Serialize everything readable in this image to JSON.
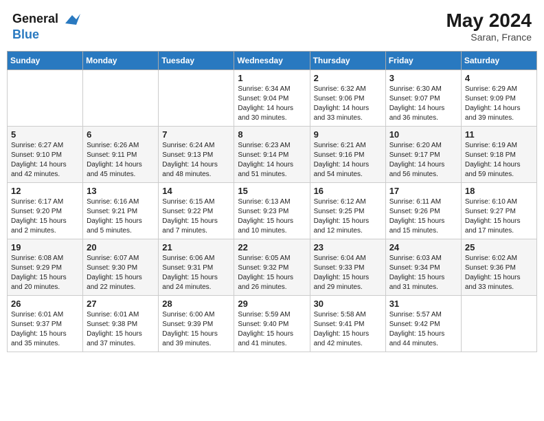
{
  "header": {
    "logo_line1": "General",
    "logo_line2": "Blue",
    "month_year": "May 2024",
    "location": "Saran, France"
  },
  "weekdays": [
    "Sunday",
    "Monday",
    "Tuesday",
    "Wednesday",
    "Thursday",
    "Friday",
    "Saturday"
  ],
  "weeks": [
    [
      {
        "num": "",
        "info": ""
      },
      {
        "num": "",
        "info": ""
      },
      {
        "num": "",
        "info": ""
      },
      {
        "num": "1",
        "info": "Sunrise: 6:34 AM\nSunset: 9:04 PM\nDaylight: 14 hours\nand 30 minutes."
      },
      {
        "num": "2",
        "info": "Sunrise: 6:32 AM\nSunset: 9:06 PM\nDaylight: 14 hours\nand 33 minutes."
      },
      {
        "num": "3",
        "info": "Sunrise: 6:30 AM\nSunset: 9:07 PM\nDaylight: 14 hours\nand 36 minutes."
      },
      {
        "num": "4",
        "info": "Sunrise: 6:29 AM\nSunset: 9:09 PM\nDaylight: 14 hours\nand 39 minutes."
      }
    ],
    [
      {
        "num": "5",
        "info": "Sunrise: 6:27 AM\nSunset: 9:10 PM\nDaylight: 14 hours\nand 42 minutes."
      },
      {
        "num": "6",
        "info": "Sunrise: 6:26 AM\nSunset: 9:11 PM\nDaylight: 14 hours\nand 45 minutes."
      },
      {
        "num": "7",
        "info": "Sunrise: 6:24 AM\nSunset: 9:13 PM\nDaylight: 14 hours\nand 48 minutes."
      },
      {
        "num": "8",
        "info": "Sunrise: 6:23 AM\nSunset: 9:14 PM\nDaylight: 14 hours\nand 51 minutes."
      },
      {
        "num": "9",
        "info": "Sunrise: 6:21 AM\nSunset: 9:16 PM\nDaylight: 14 hours\nand 54 minutes."
      },
      {
        "num": "10",
        "info": "Sunrise: 6:20 AM\nSunset: 9:17 PM\nDaylight: 14 hours\nand 56 minutes."
      },
      {
        "num": "11",
        "info": "Sunrise: 6:19 AM\nSunset: 9:18 PM\nDaylight: 14 hours\nand 59 minutes."
      }
    ],
    [
      {
        "num": "12",
        "info": "Sunrise: 6:17 AM\nSunset: 9:20 PM\nDaylight: 15 hours\nand 2 minutes."
      },
      {
        "num": "13",
        "info": "Sunrise: 6:16 AM\nSunset: 9:21 PM\nDaylight: 15 hours\nand 5 minutes."
      },
      {
        "num": "14",
        "info": "Sunrise: 6:15 AM\nSunset: 9:22 PM\nDaylight: 15 hours\nand 7 minutes."
      },
      {
        "num": "15",
        "info": "Sunrise: 6:13 AM\nSunset: 9:23 PM\nDaylight: 15 hours\nand 10 minutes."
      },
      {
        "num": "16",
        "info": "Sunrise: 6:12 AM\nSunset: 9:25 PM\nDaylight: 15 hours\nand 12 minutes."
      },
      {
        "num": "17",
        "info": "Sunrise: 6:11 AM\nSunset: 9:26 PM\nDaylight: 15 hours\nand 15 minutes."
      },
      {
        "num": "18",
        "info": "Sunrise: 6:10 AM\nSunset: 9:27 PM\nDaylight: 15 hours\nand 17 minutes."
      }
    ],
    [
      {
        "num": "19",
        "info": "Sunrise: 6:08 AM\nSunset: 9:29 PM\nDaylight: 15 hours\nand 20 minutes."
      },
      {
        "num": "20",
        "info": "Sunrise: 6:07 AM\nSunset: 9:30 PM\nDaylight: 15 hours\nand 22 minutes."
      },
      {
        "num": "21",
        "info": "Sunrise: 6:06 AM\nSunset: 9:31 PM\nDaylight: 15 hours\nand 24 minutes."
      },
      {
        "num": "22",
        "info": "Sunrise: 6:05 AM\nSunset: 9:32 PM\nDaylight: 15 hours\nand 26 minutes."
      },
      {
        "num": "23",
        "info": "Sunrise: 6:04 AM\nSunset: 9:33 PM\nDaylight: 15 hours\nand 29 minutes."
      },
      {
        "num": "24",
        "info": "Sunrise: 6:03 AM\nSunset: 9:34 PM\nDaylight: 15 hours\nand 31 minutes."
      },
      {
        "num": "25",
        "info": "Sunrise: 6:02 AM\nSunset: 9:36 PM\nDaylight: 15 hours\nand 33 minutes."
      }
    ],
    [
      {
        "num": "26",
        "info": "Sunrise: 6:01 AM\nSunset: 9:37 PM\nDaylight: 15 hours\nand 35 minutes."
      },
      {
        "num": "27",
        "info": "Sunrise: 6:01 AM\nSunset: 9:38 PM\nDaylight: 15 hours\nand 37 minutes."
      },
      {
        "num": "28",
        "info": "Sunrise: 6:00 AM\nSunset: 9:39 PM\nDaylight: 15 hours\nand 39 minutes."
      },
      {
        "num": "29",
        "info": "Sunrise: 5:59 AM\nSunset: 9:40 PM\nDaylight: 15 hours\nand 41 minutes."
      },
      {
        "num": "30",
        "info": "Sunrise: 5:58 AM\nSunset: 9:41 PM\nDaylight: 15 hours\nand 42 minutes."
      },
      {
        "num": "31",
        "info": "Sunrise: 5:57 AM\nSunset: 9:42 PM\nDaylight: 15 hours\nand 44 minutes."
      },
      {
        "num": "",
        "info": ""
      }
    ]
  ]
}
